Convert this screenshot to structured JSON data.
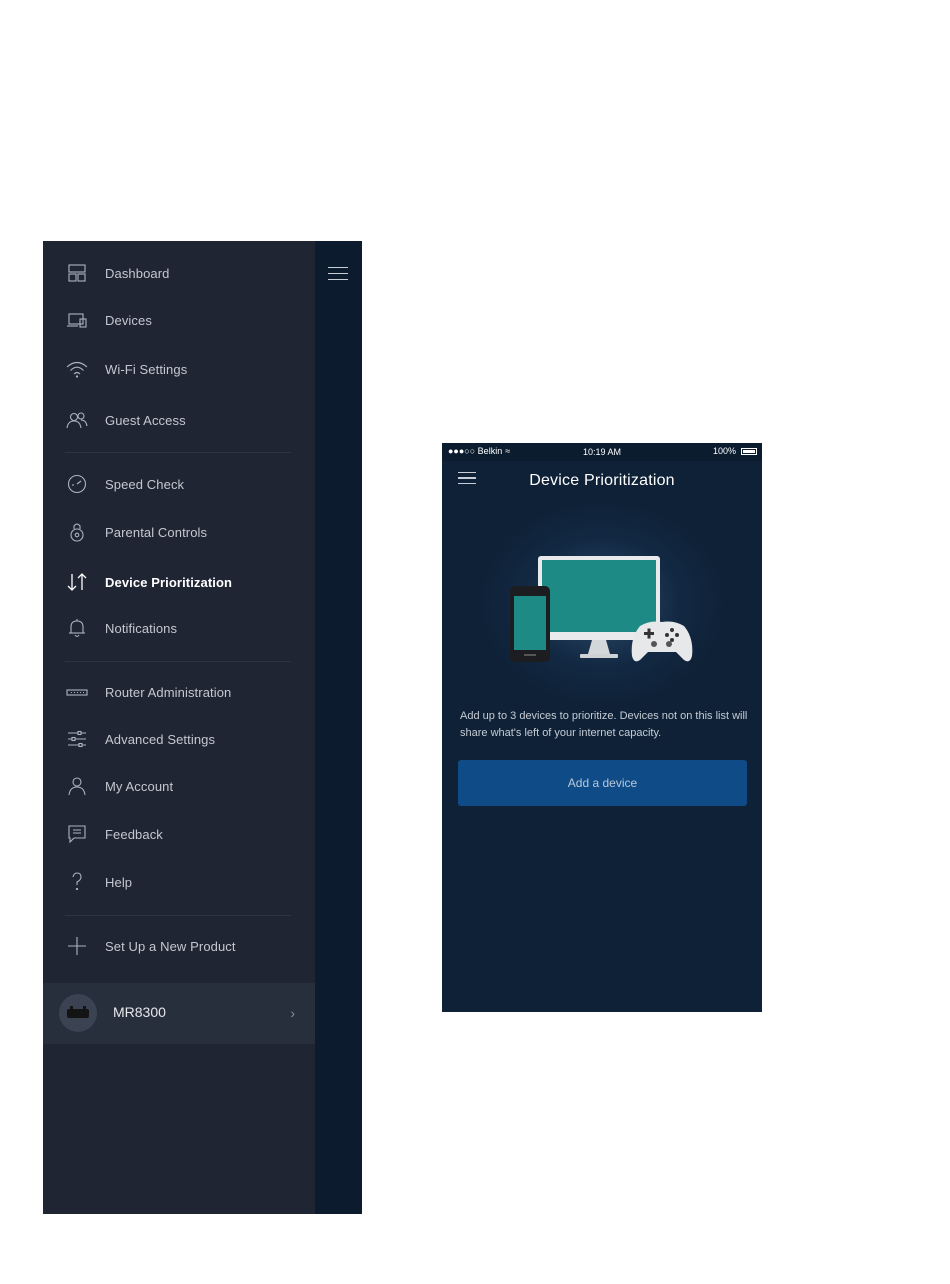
{
  "menu": {
    "items": [
      {
        "label": "Dashboard",
        "icon": "dashboard-icon"
      },
      {
        "label": "Devices",
        "icon": "devices-icon"
      },
      {
        "label": "Wi-Fi Settings",
        "icon": "wifi-icon"
      },
      {
        "label": "Guest Access",
        "icon": "guest-icon"
      },
      {
        "label": "Speed Check",
        "icon": "speedometer-icon"
      },
      {
        "label": "Parental Controls",
        "icon": "lock-icon"
      },
      {
        "label": "Device Prioritization",
        "icon": "up-down-arrows-icon",
        "active": true
      },
      {
        "label": "Notifications",
        "icon": "bell-icon"
      },
      {
        "label": "Router Administration",
        "icon": "router-icon"
      },
      {
        "label": "Advanced Settings",
        "icon": "sliders-icon"
      },
      {
        "label": "My Account",
        "icon": "user-icon"
      },
      {
        "label": "Feedback",
        "icon": "chat-icon"
      },
      {
        "label": "Help",
        "icon": "question-icon"
      },
      {
        "label": "Set Up a New Product",
        "icon": "plus-icon"
      }
    ],
    "product": {
      "name": "MR8300"
    }
  },
  "phone": {
    "status": {
      "carrier": "●●●○○ Belkin",
      "time": "10:19 AM",
      "battery": "100%"
    },
    "title": "Device Prioritization",
    "description": "Add up to 3 devices to prioritize. Devices not on this list will share what's left of your internet capacity.",
    "add_button": "Add a device"
  },
  "colors": {
    "menu_bg": "#1f2533",
    "strip_bg": "#0c1c2e",
    "phone_bg": "#0e2137",
    "button": "#0f4b86",
    "monitor_screen": "#1e8a86"
  }
}
